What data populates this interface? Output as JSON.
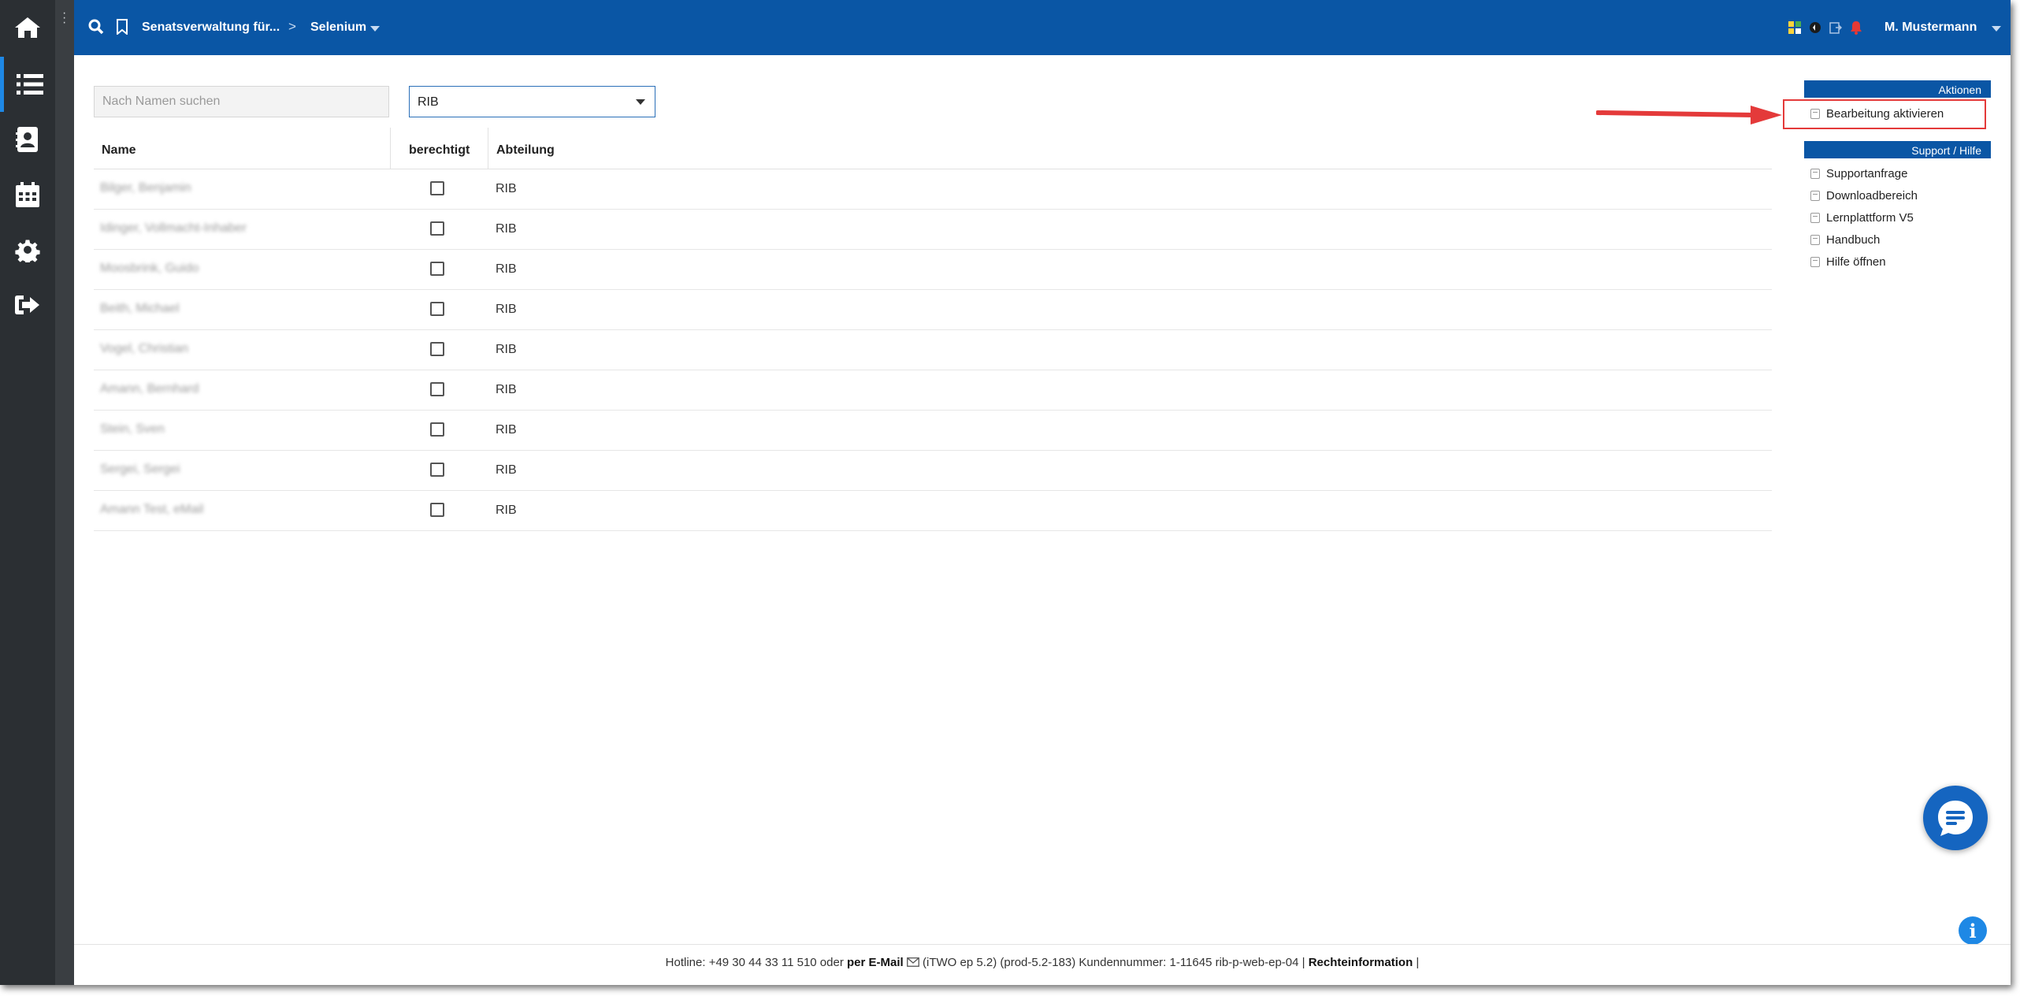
{
  "topbar": {
    "breadcrumb_org": "Senatsverwaltung für...",
    "breadcrumb_separator": ">",
    "breadcrumb_project": "Selenium",
    "user_name": "M. Mustermann"
  },
  "filters": {
    "search_placeholder": "Nach Namen suchen",
    "department_value": "RIB"
  },
  "table": {
    "columns": [
      "Name",
      "berechtigt",
      "Abteilung"
    ],
    "rows": [
      {
        "name": "Bilger, Benjamin",
        "dept": "RIB",
        "checked": false
      },
      {
        "name": "Idinger, Vollmacht-Inhaber",
        "dept": "RIB",
        "checked": false
      },
      {
        "name": "Moosbrink, Guido",
        "dept": "RIB",
        "checked": false
      },
      {
        "name": "Beith, Michael",
        "dept": "RIB",
        "checked": false
      },
      {
        "name": "Vogel, Christian",
        "dept": "RIB",
        "checked": false
      },
      {
        "name": "Amann, Bernhard",
        "dept": "RIB",
        "checked": false
      },
      {
        "name": "Stein, Sven",
        "dept": "RIB",
        "checked": false
      },
      {
        "name": "Sergei, Sergei",
        "dept": "RIB",
        "checked": false
      },
      {
        "name": "Amann Test, eMail",
        "dept": "RIB",
        "checked": false
      }
    ]
  },
  "panel": {
    "actions_title": "Aktionen",
    "actions": [
      "Bearbeitung aktivieren"
    ],
    "support_title": "Support / Hilfe",
    "support_links": [
      "Supportanfrage",
      "Downloadbereich",
      "Lernplattform V5",
      "Handbuch",
      "Hilfe öffnen"
    ]
  },
  "footer": {
    "hotline": "Hotline: +49 30 44 33 11 510 oder",
    "email_link": "per E-Mail",
    "version": "(iTWO ep 5.2) (prod-5.2-183)   Kundennummer: 1-11645 rib-p-web-ep-04 |",
    "legal_link": "Rechteinformation",
    "trailing": "|"
  },
  "info_button": "i",
  "colors": {
    "sidebar": "#2b2f33",
    "topbar": "#0a56a5",
    "accent": "#1e88e5",
    "highlight": "#e43a3a"
  },
  "icons": {
    "sidebar": [
      "home-icon",
      "list-icon",
      "contacts-icon",
      "calendar-icon",
      "gear-icon",
      "logout-icon"
    ],
    "topbar": [
      "search-icon",
      "bookmark-icon",
      "apps-icon",
      "sync-icon",
      "export-icon",
      "notification-bell-icon"
    ]
  }
}
